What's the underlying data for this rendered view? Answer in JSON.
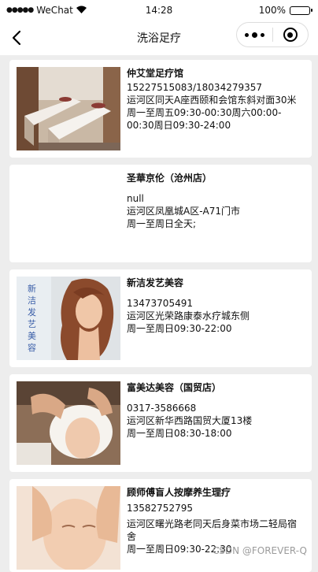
{
  "status_bar": {
    "carrier": "WeChat",
    "time": "14:28",
    "battery": "100%"
  },
  "nav": {
    "title": "洗浴足疗"
  },
  "shops": [
    {
      "name": "仲艾堂足疗馆",
      "phone": "15227515083/18034279357",
      "address": "运河区同天A座西颐和会馆东斜对面30米",
      "hours": "周一至周五09:30-00:30周六00:00-00:30周日09:30-24:00",
      "image": "massage-room"
    },
    {
      "name": "圣華京伦（沧州店）",
      "phone": "null",
      "address": "运河区凤凰城A区-A71门市",
      "hours": "周一至周日全天;",
      "image": ""
    },
    {
      "name": "新洁发艺美容",
      "phone": "13473705491",
      "address": "运河区光荣路康泰水疗城东侧",
      "hours": "周一至周日09:30-22:00",
      "image": "hair-portrait",
      "image_text": "新洁发艺美容"
    },
    {
      "name": "富美达美容（国贸店）",
      "phone": "0317-3586668",
      "address": "运河区新华西路国贸大厦13楼",
      "hours": "周一至周日08:30-18:00",
      "image": "facial-massage"
    },
    {
      "name": "顾师傅盲人按摩养生理疗",
      "phone": "13582752795",
      "address": "运河区曙光路老同天后身菜市场二轻局宿舍",
      "hours": "周一至周日09:30-22:30",
      "image": "face-massage"
    }
  ],
  "watermark": "CSDN @FOREVER-Q"
}
